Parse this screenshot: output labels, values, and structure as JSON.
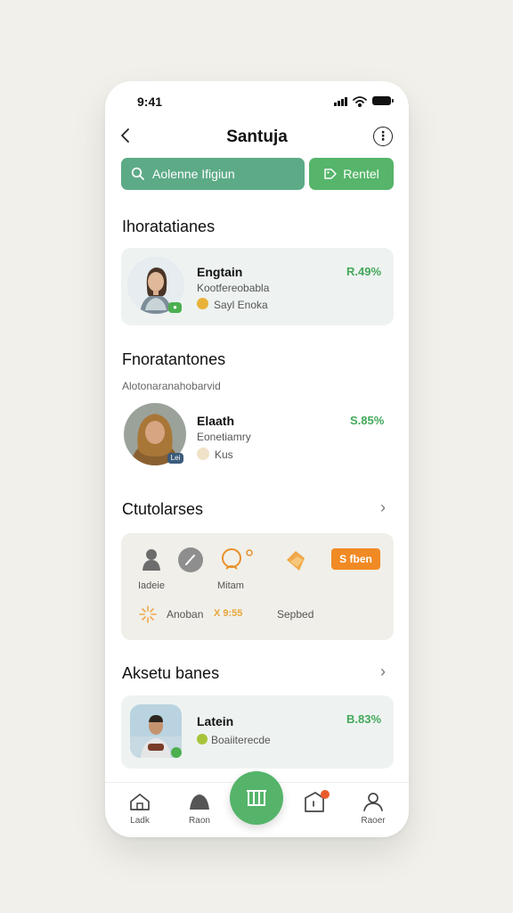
{
  "status": {
    "time": "9:41"
  },
  "header": {
    "title": "Santuja"
  },
  "search": {
    "placeholder": "Aolenne Ifigiun"
  },
  "rent_button": {
    "label": "Rentel"
  },
  "section1": {
    "title": "Ihoratatianes",
    "item": {
      "name": "Engtain",
      "subtitle": "Kootfereobabla",
      "meta": "Sayl Enoka",
      "percent": "R.49%"
    }
  },
  "section2": {
    "title": "Fnoratantones",
    "subtitle": "Alotonaranahobarvid",
    "item": {
      "name": "Elaath",
      "subtitle": "Eonetiamry",
      "meta": "Kus",
      "percent": "S.85%",
      "badge": "Lei"
    }
  },
  "section3": {
    "title": "Ctutolarses",
    "grid": {
      "label1": "Iadeie",
      "label2": "Mitam",
      "tag": "S fben",
      "row2_label1": "Anoban",
      "row2_label2": "X 9:55",
      "row2_label3": "Sepbed"
    }
  },
  "section4": {
    "title": "Aksetu banes",
    "item": {
      "name": "Latein",
      "subtitle": "Boaiiterecde",
      "percent": "B.83%"
    }
  },
  "tabbar": {
    "tab1": "Ladk",
    "tab2": "Raon",
    "tab4": "",
    "tab5": "Raoer"
  },
  "colors": {
    "accent_green": "#56b56a",
    "search_green": "#5daa87",
    "tag_orange": "#f08a24",
    "percent_green": "#43a85a"
  }
}
